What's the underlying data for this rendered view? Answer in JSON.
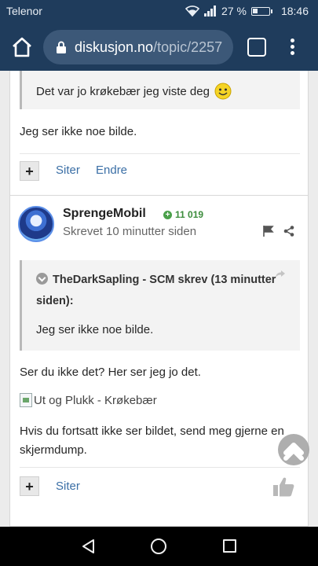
{
  "status_bar": {
    "carrier": "Telenor",
    "battery_percent": "27 %",
    "time": "18:46",
    "icons": [
      "wifi-icon",
      "signal-icon",
      "battery-icon"
    ]
  },
  "browser": {
    "url_host": "diskusjon.no",
    "url_path": "/topic/2257",
    "icons": [
      "home-icon",
      "lock-icon",
      "tabs-icon",
      "overflow-menu-icon"
    ]
  },
  "post1": {
    "quote_text": "Det var jo krøkebær jeg viste deg",
    "quote_emoji": "smiley-icon",
    "body": "Jeg ser ikke noe bilde.",
    "actions": {
      "quote_label": "Siter",
      "edit_label": "Endre"
    }
  },
  "post2": {
    "author": "SprengeMobil",
    "reputation": "11 019",
    "posted": "Skrevet 10 minutter siden",
    "quote_header": "TheDarkSapling - SCM skrev (13 minutter siden):",
    "quote_text": "Jeg ser ikke noe bilde.",
    "paragraph1": "Ser du ikke det? Her ser jeg jo det.",
    "image_alt": "Ut og Plukk - Krøkebær",
    "paragraph2": "Hvis du fortsatt ikke ser bildet, send meg gjerne en skjermdump.",
    "actions": {
      "quote_label": "Siter"
    }
  },
  "colors": {
    "browser_bar": "#1f3c5c",
    "url_field": "#3c5878",
    "link": "#3b6fa6",
    "reputation": "#3c8c3c"
  },
  "nav_bar": {
    "icons": [
      "back-icon",
      "home-circle-icon",
      "recent-apps-icon"
    ]
  }
}
